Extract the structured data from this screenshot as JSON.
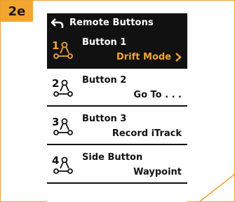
{
  "step_tag": "2e",
  "header": {
    "title": "Remote Buttons",
    "back_icon": "back-arrow-icon"
  },
  "accent_color": "#f3a531",
  "buttons": [
    {
      "number": "1",
      "name": "Button 1",
      "value": "Drift Mode",
      "selected": true,
      "icon": "remote-button-icon"
    },
    {
      "number": "2",
      "name": "Button 2",
      "value": "Go To . . .",
      "selected": false,
      "icon": "remote-button-icon"
    },
    {
      "number": "3",
      "name": "Button 3",
      "value": "Record iTrack",
      "selected": false,
      "icon": "remote-button-icon"
    },
    {
      "number": "4",
      "name": "Side Button",
      "value": "Waypoint",
      "selected": false,
      "icon": "remote-button-icon"
    }
  ]
}
